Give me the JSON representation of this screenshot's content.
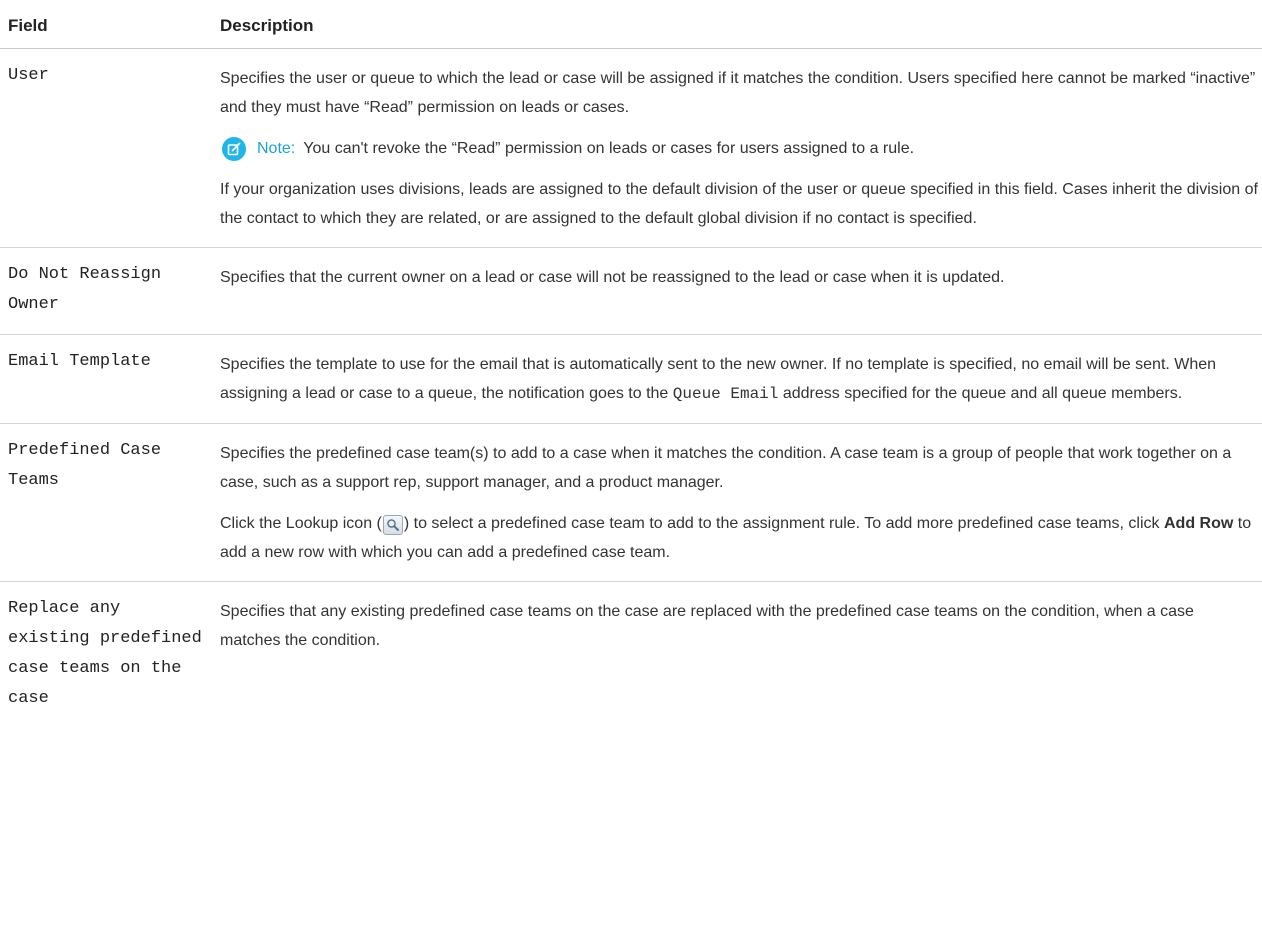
{
  "table": {
    "headers": {
      "field": "Field",
      "description": "Description"
    },
    "rows": [
      {
        "field": "User",
        "description": {
          "p1": "Specifies the user or queue to which the lead or case will be assigned if it matches the condition. Users specified here cannot be marked “inactive” and they must have “Read” permission on leads or cases.",
          "note_label": "Note:",
          "note_text": "You can't revoke the “Read” permission on leads or cases for users assigned to a rule.",
          "p2": "If your organization uses divisions, leads are assigned to the default division of the user or queue specified in this field. Cases inherit the division of the contact to which they are related, or are assigned to the default global division if no contact is specified."
        }
      },
      {
        "field": "Do Not Reassign Owner",
        "description": {
          "p1": "Specifies that the current owner on a lead or case will not be reassigned to the lead or case when it is updated."
        }
      },
      {
        "field": "Email Template",
        "description": {
          "p1_before": "Specifies the template to use for the email that is automatically sent to the new owner. If no template is specified, no email will be sent. When assigning a lead or case to a queue, the notification goes to the",
          "p1_code": "Queue Email",
          "p1_after": "address specified for the queue and all queue members."
        }
      },
      {
        "field": "Predefined Case Teams",
        "description": {
          "p1": "Specifies the predefined case team(s) to add to a case when it matches the condition. A case team is a group of people that work together on a case, such as a support rep, support manager, and a product manager.",
          "p2_before": "Click the Lookup icon (",
          "p2_middle": ") to select a predefined case team to add to the assignment rule. To add more predefined case teams, click",
          "p2_bold": "Add Row",
          "p2_after": "to add a new row with which you can add a predefined case team.",
          "icon": "lookup-magnifier-icon"
        }
      },
      {
        "field": "Replace any existing predefined case teams on the case",
        "description": {
          "p1": "Specifies that any existing predefined case teams on the case are replaced with the predefined case teams on the condition, when a case matches the condition."
        }
      }
    ]
  },
  "colors": {
    "note_accent": "#1ba3d4",
    "note_icon_bg": "#1fb6e8",
    "divider": "#d4d4d4",
    "text": "#333333"
  }
}
